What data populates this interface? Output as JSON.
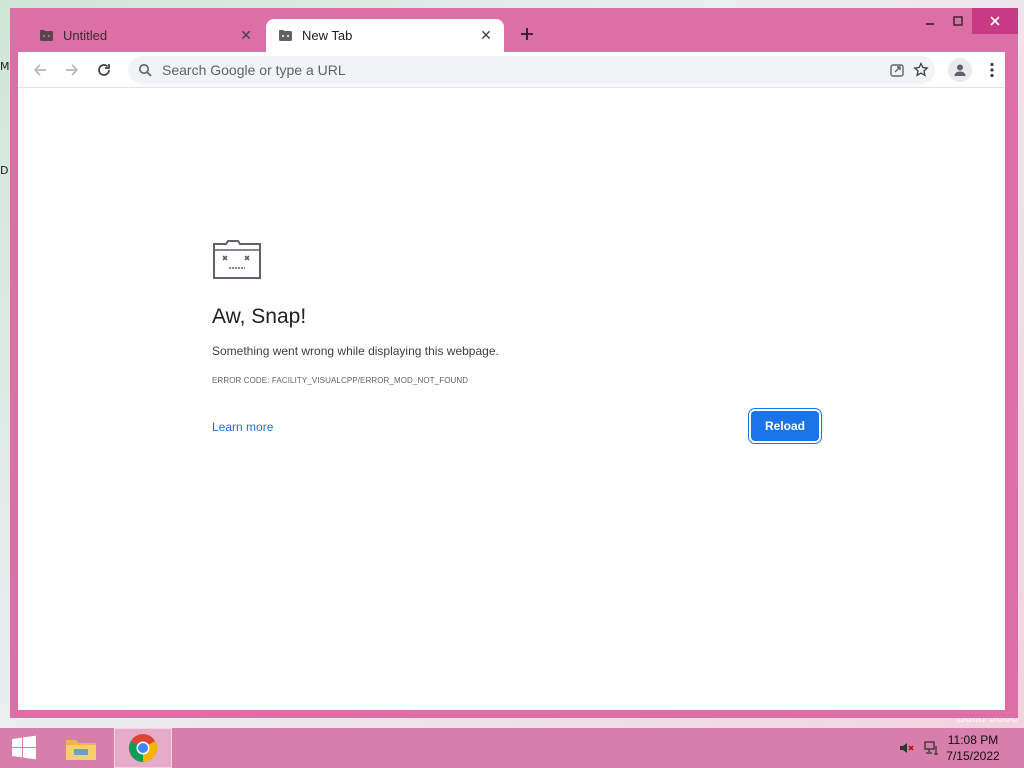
{
  "desktop": {
    "edge_label_1": "M",
    "edge_label_2": "D",
    "watermark": "Build 9600"
  },
  "window": {
    "controls": {
      "minimize": "–",
      "maximize": "□",
      "close": "✕"
    }
  },
  "tabs": [
    {
      "title": "Untitled",
      "close": "✕",
      "active": false
    },
    {
      "title": "New Tab",
      "close": "✕",
      "active": true
    }
  ],
  "toolbar": {
    "omnibox_placeholder": "Search Google or type a URL"
  },
  "page": {
    "title": "Aw, Snap!",
    "message": "Something went wrong while displaying this webpage.",
    "error_code": "Error code: FACILITY_VISUALCPP/ERROR_MOD_NOT_FOUND",
    "learn_more": "Learn more",
    "reload_label": "Reload"
  },
  "taskbar": {
    "time": "11:08 PM",
    "date": "7/15/2022"
  },
  "colors": {
    "window_frame": "#dc6fa6",
    "accent": "#1a73e8",
    "taskbar": "#d77eaa"
  }
}
